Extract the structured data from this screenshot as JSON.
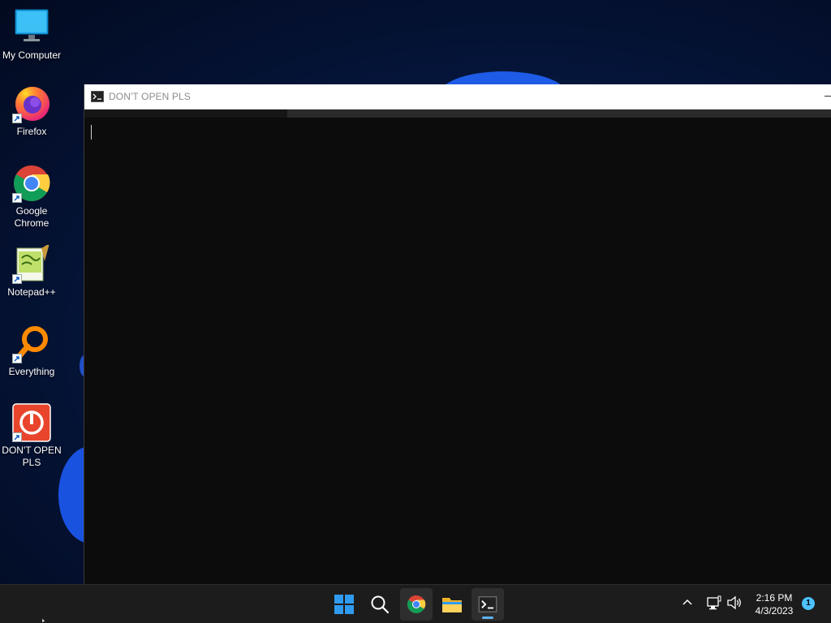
{
  "desktop": {
    "icons": [
      {
        "label": "My Computer",
        "icon": "monitor-icon"
      },
      {
        "label": "Firefox",
        "icon": "firefox-icon"
      },
      {
        "label": "Google Chrome",
        "icon": "chrome-icon"
      },
      {
        "label": "Notepad++",
        "icon": "notepadpp-icon"
      },
      {
        "label": "Everything",
        "icon": "everything-search-icon"
      },
      {
        "label": "DON'T OPEN PLS",
        "icon": "power-icon"
      }
    ]
  },
  "window": {
    "title": "DON'T OPEN PLS",
    "icon": "console-icon",
    "content": ""
  },
  "taskbar": {
    "items": [
      {
        "name": "start",
        "icon": "windows-logo-icon"
      },
      {
        "name": "search",
        "icon": "search-icon"
      },
      {
        "name": "chrome",
        "icon": "chrome-icon"
      },
      {
        "name": "file-explorer",
        "icon": "folder-icon"
      },
      {
        "name": "console",
        "icon": "console-icon",
        "active": true
      }
    ],
    "tray": {
      "time": "2:16 PM",
      "date": "4/3/2023",
      "notification_count": "1"
    }
  },
  "colors": {
    "console_bg": "#0c0c0c",
    "taskbar_bg": "#1c1c1c",
    "accent": "#4cc2ff"
  }
}
